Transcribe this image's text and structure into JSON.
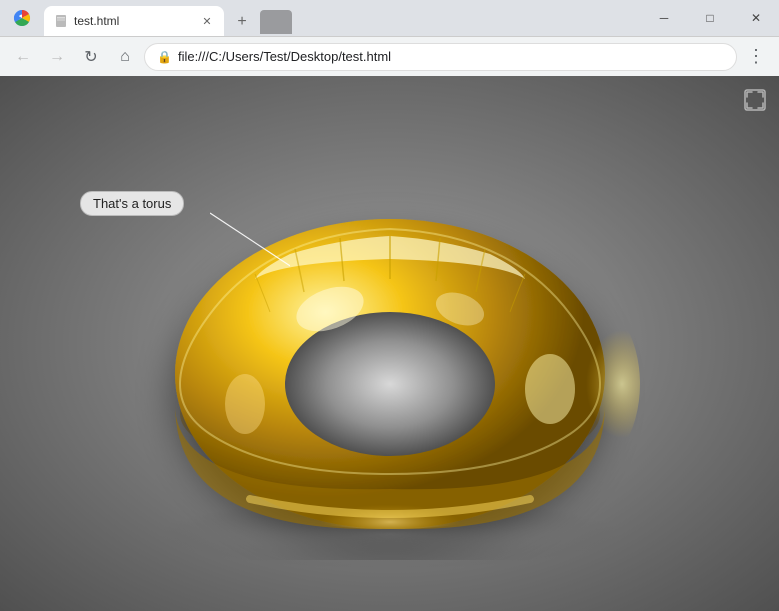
{
  "titleBar": {
    "menuIcon": "≡",
    "tab": {
      "title": "test.html",
      "icon": "📄"
    },
    "newTabIcon": "+",
    "windowControls": {
      "minimize": "─",
      "maximize": "□",
      "close": "✕"
    }
  },
  "navBar": {
    "back": "←",
    "forward": "→",
    "refresh": "↻",
    "home": "⌂",
    "lockIcon": "🔒",
    "address": "file:///C:/Users/Test/Desktop/test.html",
    "moreOptions": "⋮"
  },
  "webpage": {
    "tooltip": "That's a torus",
    "fullscreenTitle": "fullscreen"
  }
}
